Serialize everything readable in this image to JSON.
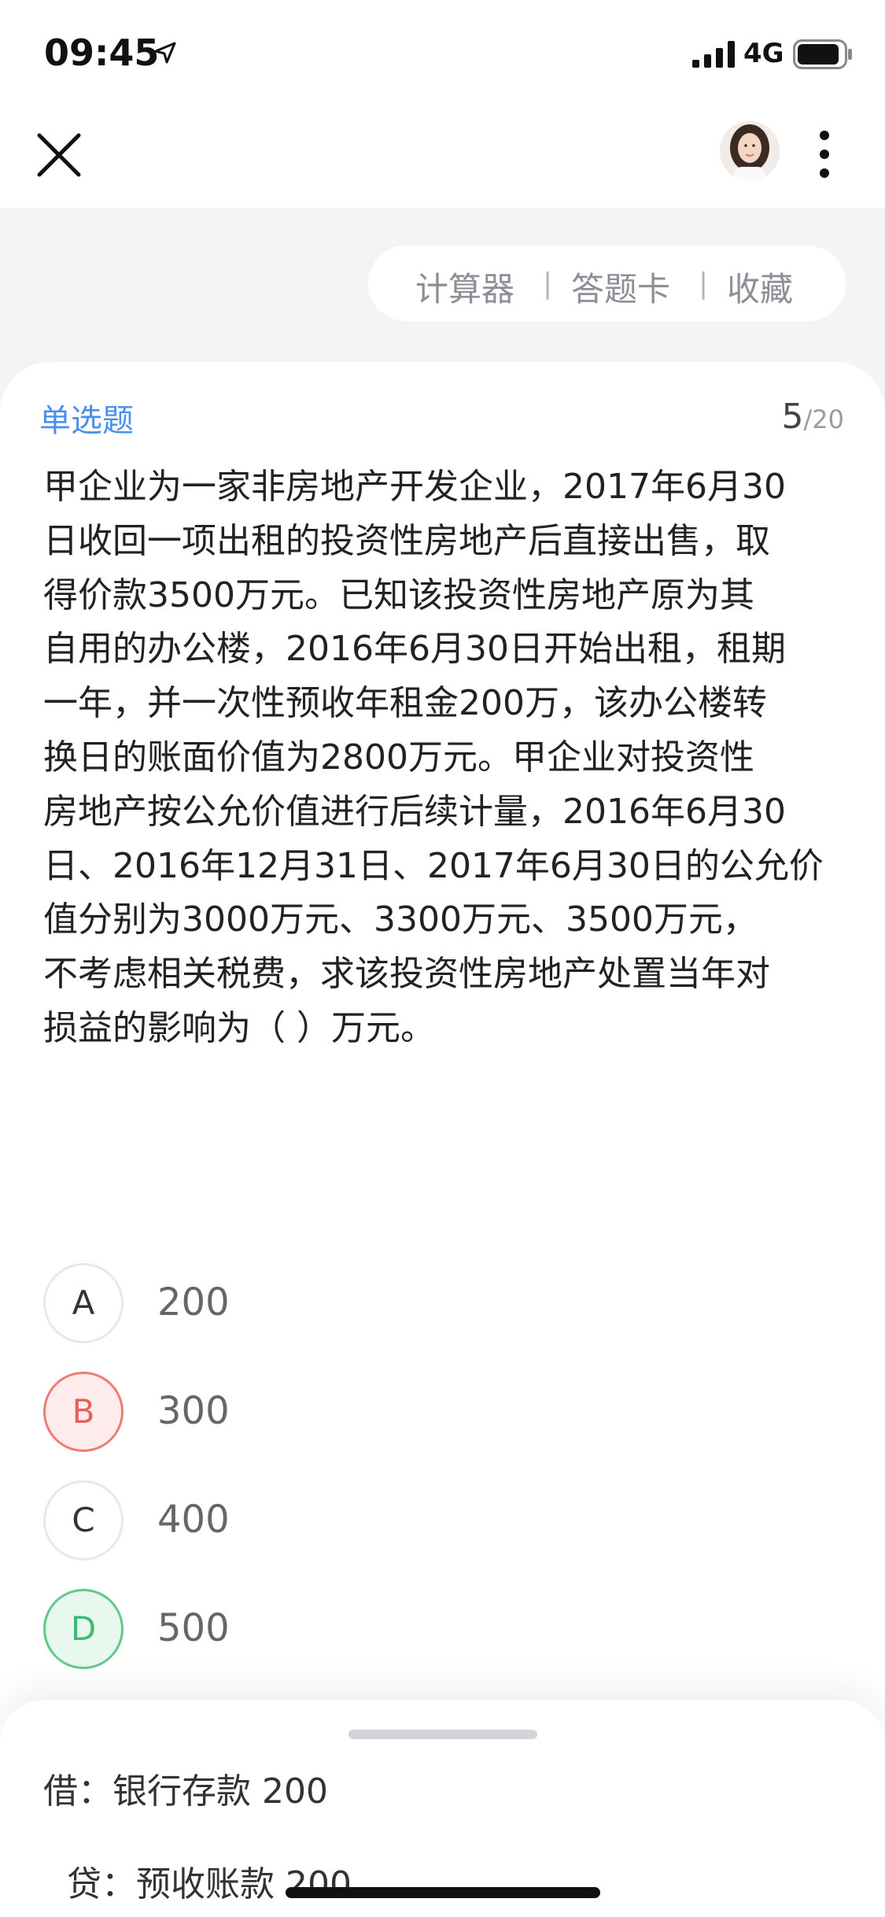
{
  "status_bar": {
    "time": "09:45",
    "network": "4G"
  },
  "nav": {
    "close_icon": "close-icon",
    "avatar": "user-avatar",
    "more_icon": "more-vertical-icon"
  },
  "toolbar": {
    "calculator": "计算器",
    "answer_card": "答题卡",
    "favorite": "收藏",
    "separator": "|"
  },
  "question": {
    "type": "单选题",
    "current": "5",
    "total": "/20",
    "text": "甲企业为一家非房地产开发企业，2017年6月30\n日收回一项出租的投资性房地产后直接出售，取\n得价款3500万元。已知该投资性房地产原为其\n自用的办公楼，2016年6月30日开始出租，租期\n一年，并一次性预收年租金200万，该办公楼转\n换日的账面价值为2800万元。甲企业对投资性\n房地产按公允价值进行后续计量，2016年6月30\n日、2016年12月31日、2017年6月30日的公允价\n值分别为3000万元、3300万元、3500万元，\n不考虑相关税费，求该投资性房地产处置当年对\n损益的影响为（    ）万元。",
    "options": [
      {
        "letter": "A",
        "text": "200",
        "state": "normal"
      },
      {
        "letter": "B",
        "text": "300",
        "state": "wrong"
      },
      {
        "letter": "C",
        "text": "400",
        "state": "normal"
      },
      {
        "letter": "D",
        "text": "500",
        "state": "correct"
      }
    ]
  },
  "analysis": {
    "line1": "借：银行存款 200",
    "line2": "贷：预收账款 200"
  },
  "colors": {
    "accent": "#4a8ff0",
    "wrong": "#e5615b",
    "correct": "#3fb971"
  }
}
